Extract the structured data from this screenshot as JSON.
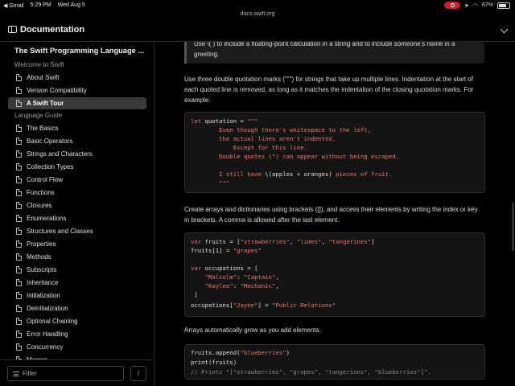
{
  "status_bar": {
    "back_app": "◀ Gmail",
    "time": "5:29 PM",
    "date": "Wed Aug 5",
    "url": "docs.swift.org",
    "battery": "67%"
  },
  "topnav": {
    "title": "Documentation"
  },
  "sidebar": {
    "book_title": "The Swift Programming Language ...",
    "section_welcome": "Welcome to Swift",
    "welcome_items": [
      "About Swift",
      "Version Compatibility",
      "A Swift Tour"
    ],
    "active_item": "A Swift Tour",
    "section_guide": "Language Guide",
    "guide_items": [
      "The Basics",
      "Basic Operators",
      "Strings and Characters",
      "Collection Types",
      "Control Flow",
      "Functions",
      "Closures",
      "Enumerations",
      "Structures and Classes",
      "Properties",
      "Methods",
      "Subscripts",
      "Inheritance",
      "Initialization",
      "Deinitialization",
      "Optional Chaining",
      "Error Handling",
      "Concurrency",
      "Macros"
    ],
    "filter_placeholder": "Filter",
    "filter_shortcut": "/"
  },
  "content": {
    "note_line1": "Use \\( ) to include a floating-point calculation in a string and to include someone’s name in a",
    "note_line2": "greeting.",
    "para1_line1": "Use three double quotation marks (\"\"\") for strings that take up multiple lines. Indentation at the start of",
    "para1_line2": "each quoted line is removed, as long as it matches the indentation of the closing quotation marks. For",
    "para1_line3": "example:",
    "code1": {
      "l1_kw": "let",
      "l1_rest": " quotation = ",
      "l1_str": "\"\"\"",
      "l2": "        Even though there's whitespace to the left,",
      "l3": "        the actual lines aren't indented.",
      "l4": "            Except for this line.",
      "l5": "        Double quotes (\") can appear without being escaped.",
      "l6_a": "        I still have ",
      "l6_b": "\\(apples + oranges)",
      "l6_c": " pieces of fruit.",
      "l7": "        \"\"\""
    },
    "para2_line1": "Create arrays and dictionaries using brackets ([]), and access their elements by writing the index or key",
    "para2_line2": "in brackets. A comma is allowed after the last element.",
    "code2": {
      "l1_kw": "var",
      "l1_rest": " fruits = [",
      "l1_s1": "\"strawberries\"",
      "l1_c1": ", ",
      "l1_s2": "\"limes\"",
      "l1_c2": ", ",
      "l1_s3": "\"tangerines\"",
      "l1_end": "]",
      "l2_a": "fruits[1] = ",
      "l2_s": "\"grapes\"",
      "l4_kw": "var",
      "l4_rest": " occupations = [",
      "l5_s1": "    \"Malcolm\"",
      "l5_mid": ": ",
      "l5_s2": "\"Captain\"",
      "l5_end": ",",
      "l6_s1": "    \"Kaylee\"",
      "l6_mid": ": ",
      "l6_s2": "\"Mechanic\"",
      "l6_end": ",",
      "l7": " ]",
      "l8_a": "occupations[",
      "l8_s1": "\"Jayne\"",
      "l8_b": "] = ",
      "l8_s2": "\"Public Relations\""
    },
    "para3": "Arrays automatically grow as you add elements.",
    "code3": {
      "l1_a": "fruits.append(",
      "l1_s": "\"blueberries\"",
      "l1_b": ")",
      "l2": "print(fruits)",
      "l3": "// Prints \"[\"strawberries\", \"grapes\", \"tangerines\", \"blueberries\"]\"."
    }
  }
}
